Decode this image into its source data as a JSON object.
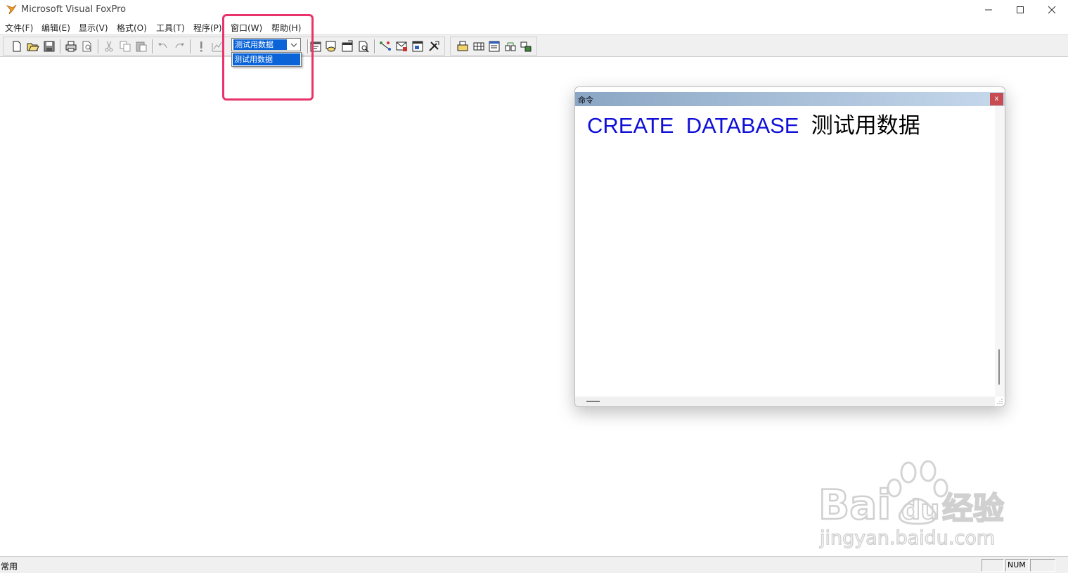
{
  "window": {
    "title": "Microsoft Visual FoxPro",
    "controls": {
      "minimize": "—",
      "maximize": "☐",
      "close": "✕"
    }
  },
  "menu": [
    {
      "label": "文件(F)"
    },
    {
      "label": "编辑(E)"
    },
    {
      "label": "显示(V)"
    },
    {
      "label": "格式(O)"
    },
    {
      "label": "工具(T)"
    },
    {
      "label": "程序(P)"
    },
    {
      "label": "窗口(W)"
    },
    {
      "label": "帮助(H)"
    }
  ],
  "toolbar": {
    "database_combo": {
      "selected": "测试用数据",
      "options": [
        "测试用数据"
      ]
    },
    "icons": [
      "new-icon",
      "open-icon",
      "save-icon",
      "print-icon",
      "print-preview-icon",
      "cut-icon",
      "copy-icon",
      "paste-icon",
      "undo-icon",
      "redo-icon",
      "run-icon",
      "modify-form-icon",
      "command-window-icon",
      "data-session-icon",
      "properties-icon",
      "code-icon",
      "form-control-icon",
      "table-designer-icon",
      "form-wizard-icon",
      "builder-icon",
      "report-icon",
      "grid-icon",
      "form-icon",
      "query-icon",
      "view-icon"
    ]
  },
  "command_window": {
    "title": "命令",
    "close_label": "x",
    "line": {
      "keyword1": "CREATE",
      "keyword2": "DATABASE",
      "argument": "测试用数据"
    }
  },
  "watermark": {
    "brand": "Bai",
    "brand2": "du",
    "cn": "经验",
    "url": "jingyan.baidu.com"
  },
  "statusbar": {
    "text": "常用",
    "num": "NUM"
  },
  "colors": {
    "highlight": "#e8336b",
    "selection": "#0a64d8",
    "keyword": "#1010d8"
  }
}
